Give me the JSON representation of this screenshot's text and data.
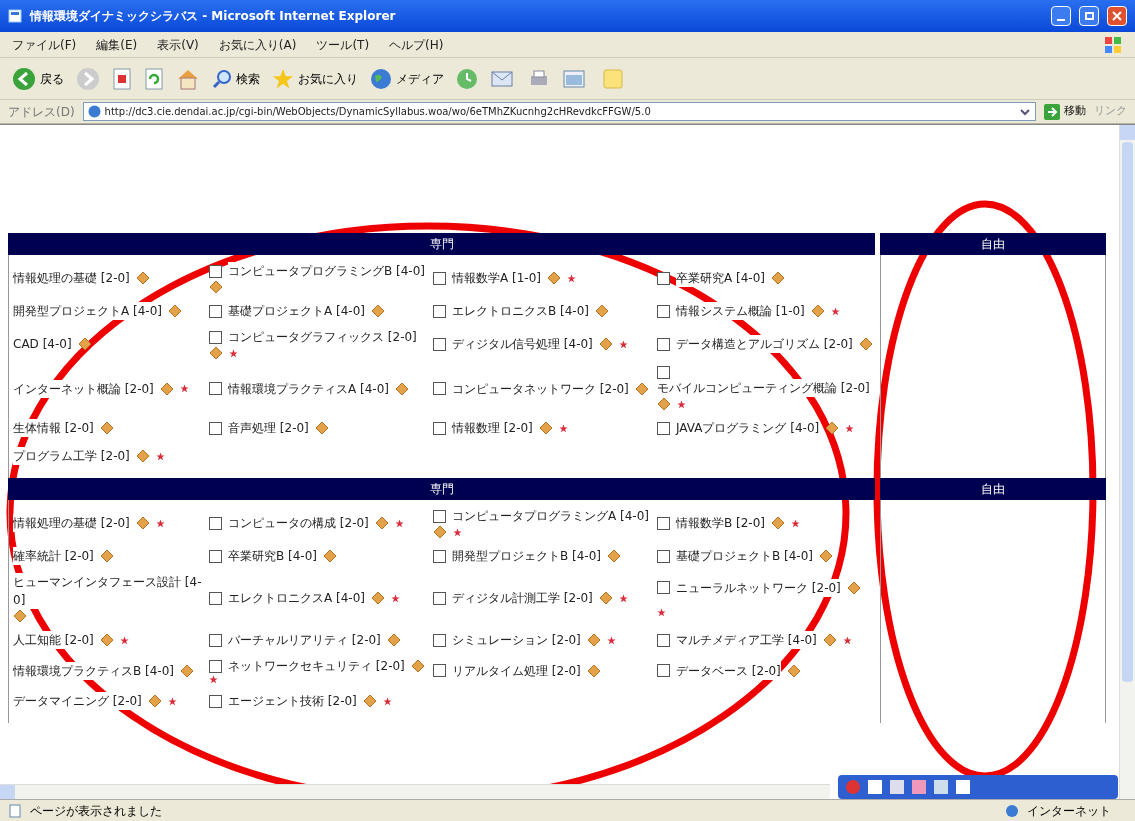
{
  "window": {
    "title": "情報環境ダイナミックシラバス - Microsoft Internet Explorer"
  },
  "menu": [
    "ファイル(F)",
    "編集(E)",
    "表示(V)",
    "お気に入り(A)",
    "ツール(T)",
    "ヘルプ(H)"
  ],
  "toolbar": {
    "back": "戻る",
    "search": "検索",
    "favorites": "お気に入り",
    "media": "メディア"
  },
  "address": {
    "label": "アドレス(D)",
    "url": "http://dc3.cie.dendai.ac.jp/cgi-bin/WebObjects/DynamicSyllabus.woa/wo/6eTMhZKucnhg2cHRevdkcFFGW/5.0",
    "go": "移動",
    "links": "リンク"
  },
  "sections": [
    {
      "heading": "専門",
      "side_heading": "自由",
      "rows": [
        [
          {
            "kind": "plain",
            "name": "情報処理の基礎 [2-0]",
            "star": false
          },
          {
            "kind": "checkbox",
            "checked": false,
            "name": "コンピュータプログラミングB [4-0]",
            "star": false
          },
          {
            "kind": "checkbox",
            "checked": false,
            "name": "情報数学A [1-0]",
            "star": true
          },
          {
            "kind": "checkbox",
            "checked": false,
            "name": "卒業研究A [4-0]",
            "star": false
          }
        ],
        [
          {
            "kind": "plain",
            "name": "開発型プロジェクトA [4-0]",
            "star": false
          },
          {
            "kind": "checkbox",
            "checked": false,
            "name": "基礎プロジェクトA [4-0]",
            "star": false
          },
          {
            "kind": "checkbox",
            "checked": false,
            "name": "エレクトロニクスB [4-0]",
            "star": false
          },
          {
            "kind": "checkbox",
            "checked": false,
            "name": "情報システム概論 [1-0]",
            "star": true
          }
        ],
        [
          {
            "kind": "plain",
            "name": "CAD [4-0]",
            "star": false
          },
          {
            "kind": "checkbox",
            "checked": false,
            "name": "コンピュータグラフィックス [2-0]",
            "star": true
          },
          {
            "kind": "checkbox",
            "checked": false,
            "name": "ディジタル信号処理 [4-0]",
            "star": true
          },
          {
            "kind": "checkbox",
            "checked": false,
            "name": "データ構造とアルゴリズム [2-0]",
            "star": false
          }
        ],
        [
          {
            "kind": "plain",
            "name": "インターネット概論 [2-0]",
            "star": true
          },
          {
            "kind": "checkbox",
            "checked": false,
            "name": "情報環境プラクティスA [4-0]",
            "star": false
          },
          {
            "kind": "checkbox",
            "checked": false,
            "name": "コンピュータネットワーク [2-0]",
            "star": false
          },
          {
            "kind": "checkbox",
            "checked": false,
            "name": "モバイルコンピューティング概論 [2-0]",
            "star": true
          }
        ],
        [
          {
            "kind": "plain",
            "name": "生体情報 [2-0]",
            "star": false
          },
          {
            "kind": "checkbox",
            "checked": false,
            "name": "音声処理 [2-0]",
            "star": false
          },
          {
            "kind": "checkbox",
            "checked": false,
            "name": "情報数理 [2-0]",
            "star": true
          },
          {
            "kind": "checkbox",
            "checked": false,
            "name": "JAVAプログラミング [4-0]",
            "star": true
          }
        ],
        [
          {
            "kind": "plain",
            "name": "プログラム工学 [2-0]",
            "star": true
          }
        ]
      ]
    },
    {
      "heading": "専門",
      "side_heading": "自由",
      "rows": [
        [
          {
            "kind": "plain",
            "name": "情報処理の基礎 [2-0]",
            "star": true
          },
          {
            "kind": "checkbox",
            "checked": false,
            "name": "コンピュータの構成 [2-0]",
            "star": true
          },
          {
            "kind": "checkbox",
            "checked": false,
            "name": "コンピュータプログラミングA [4-0]",
            "star": true
          },
          {
            "kind": "checkbox",
            "checked": false,
            "name": "情報数学B [2-0]",
            "star": true
          }
        ],
        [
          {
            "kind": "plain",
            "name": "確率統計 [2-0]",
            "star": false
          },
          {
            "kind": "checkbox",
            "checked": false,
            "name": "卒業研究B [4-0]",
            "star": false
          },
          {
            "kind": "checkbox",
            "checked": false,
            "name": "開発型プロジェクトB [4-0]",
            "star": false
          },
          {
            "kind": "checkbox",
            "checked": false,
            "name": "基礎プロジェクトB [4-0]",
            "star": false
          }
        ],
        [
          {
            "kind": "plain",
            "name": "ヒューマンインタフェース設計 [4-0]",
            "star": false
          },
          {
            "kind": "checkbox",
            "checked": false,
            "name": "エレクトロニクスA [4-0]",
            "star": true
          },
          {
            "kind": "checkbox",
            "checked": false,
            "name": "ディジタル計測工学 [2-0]",
            "star": true
          },
          {
            "kind": "checkbox",
            "checked": false,
            "name": "ニューラルネットワーク [2-0]",
            "star": true
          }
        ],
        [
          {
            "kind": "plain",
            "name": "人工知能 [2-0]",
            "star": true
          },
          {
            "kind": "checkbox",
            "checked": false,
            "name": "バーチャルリアリティ [2-0]",
            "star": false
          },
          {
            "kind": "checkbox",
            "checked": false,
            "name": "シミュレーション [2-0]",
            "star": true
          },
          {
            "kind": "checkbox",
            "checked": false,
            "name": "マルチメディア工学 [4-0]",
            "star": true
          }
        ],
        [
          {
            "kind": "plain",
            "name": "情報環境プラクティスB [4-0]",
            "star": false
          },
          {
            "kind": "checkbox",
            "checked": false,
            "name": "ネットワークセキュリティ [2-0]",
            "star": true
          },
          {
            "kind": "checkbox",
            "checked": false,
            "name": "リアルタイム処理 [2-0]",
            "star": false
          },
          {
            "kind": "checkbox",
            "checked": false,
            "name": "データベース [2-0]",
            "star": false
          }
        ],
        [
          {
            "kind": "plain",
            "name": "データマイニング [2-0]",
            "star": true
          },
          {
            "kind": "checkbox",
            "checked": false,
            "name": "エージェント技術 [2-0]",
            "star": true
          }
        ]
      ]
    }
  ],
  "status_bar": {
    "text": "ページが表示されました",
    "zone": "インターネット"
  }
}
